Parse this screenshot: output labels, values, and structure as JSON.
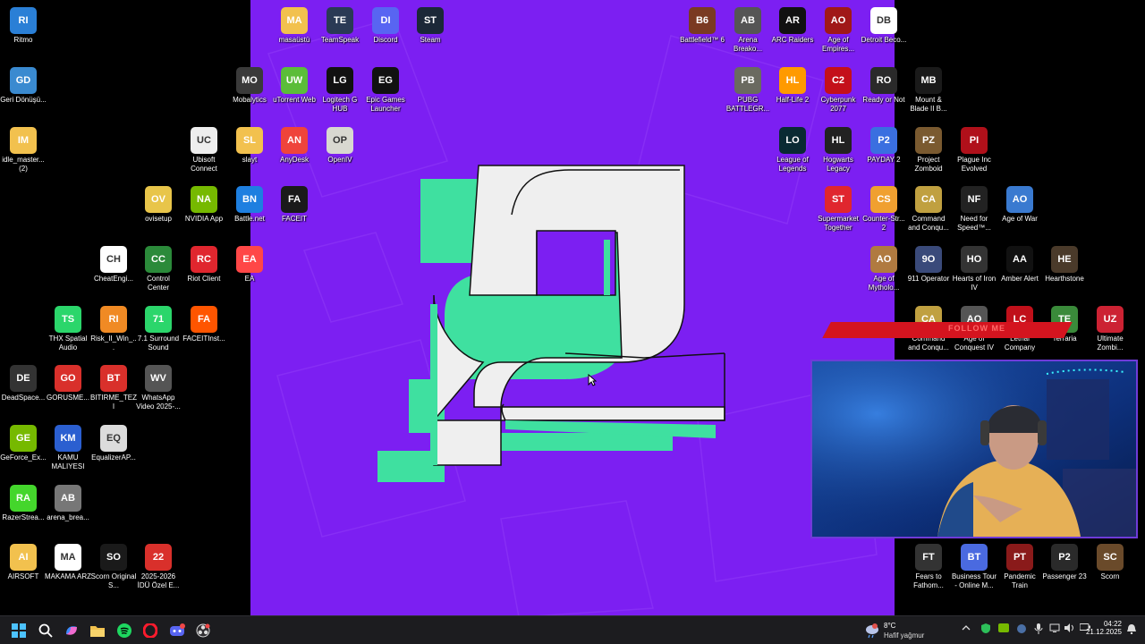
{
  "desktop_icons_left": [
    {
      "label": "Ritmo",
      "icon": "monitor-icon",
      "color": "#2a7fd6"
    },
    {
      "label": "Geri Dönüşü...",
      "icon": "recycle-bin-icon",
      "color": "#3a8ad0"
    },
    {
      "label": "idle_master... (2)",
      "icon": "folder-icon",
      "color": "#f2c14e"
    },
    {
      "label": "DeadSpace...",
      "icon": "deadspace-icon",
      "color": "#333333"
    },
    {
      "label": "GeForce_Ex...",
      "icon": "nvidia-icon",
      "color": "#76b900"
    },
    {
      "label": "RazerStrea...",
      "icon": "razer-icon",
      "color": "#44d62c"
    },
    {
      "label": "AIRSOFT",
      "icon": "folder-icon",
      "color": "#f2c14e"
    },
    {
      "label": "THX Spatial Audio",
      "icon": "thx-icon",
      "color": "#2bd66b"
    },
    {
      "label": "GORUSME...",
      "icon": "pdf-icon",
      "color": "#d9302b"
    },
    {
      "label": "KAMU MALIYESI",
      "icon": "word-icon",
      "color": "#2b5fd0"
    },
    {
      "label": "arena_brea...",
      "icon": "image-icon",
      "color": "#777777"
    },
    {
      "label": "MAKAMA ARZ",
      "icon": "document-icon",
      "color": "#ffffff"
    },
    {
      "label": "ovisetup",
      "icon": "file-icon",
      "color": "#e8c54a"
    },
    {
      "label": "CheatEngi...",
      "icon": "download-icon",
      "color": "#ffffff"
    },
    {
      "label": "Risk_II_Win_...",
      "icon": "folder-icon",
      "color": "#f08a24"
    },
    {
      "label": "BITIRME_TEZI",
      "icon": "pdf-icon",
      "color": "#d9302b"
    },
    {
      "label": "EqualizerAP...",
      "icon": "equalizer-icon",
      "color": "#dcdcdc"
    },
    {
      "label": "Scorn Original S...",
      "icon": "music-icon",
      "color": "#1a1a1a"
    },
    {
      "label": "Ubisoft Connect",
      "icon": "ubisoft-icon",
      "color": "#eeeeee"
    },
    {
      "label": "NVIDIA App",
      "icon": "nvidia-icon",
      "color": "#76b900"
    },
    {
      "label": "Control Center",
      "icon": "control-center-icon",
      "color": "#2b8a3a"
    },
    {
      "label": "7.1 Surround Sound",
      "icon": "surround-icon",
      "color": "#2bd66b"
    },
    {
      "label": "WhatsApp Video 2025-...",
      "icon": "video-icon",
      "color": "#555555"
    },
    {
      "label": "2025-2026 İDÜ Özel E...",
      "icon": "pdf-icon",
      "color": "#d9302b"
    },
    {
      "label": "slayt",
      "icon": "folder-icon",
      "color": "#f2c14e"
    },
    {
      "label": "Battle.net",
      "icon": "battlenet-icon",
      "color": "#1e7fe0"
    },
    {
      "label": "Riot Client",
      "icon": "riot-icon",
      "color": "#e0262e"
    },
    {
      "label": "FACEITInst...",
      "icon": "faceit-icon",
      "color": "#ff5500"
    },
    {
      "label": "EA",
      "icon": "ea-icon",
      "color": "#ff4747"
    }
  ],
  "desktop_icons_wall": [
    {
      "label": "masaüstü",
      "icon": "folder-icon",
      "color": "#f2c14e"
    },
    {
      "label": "TeamSpeak",
      "icon": "teamspeak-icon",
      "color": "#2a3a55"
    },
    {
      "label": "Discord",
      "icon": "discord-icon",
      "color": "#5865f2"
    },
    {
      "label": "Steam",
      "icon": "steam-icon",
      "color": "#1b2838"
    },
    {
      "label": "Mobalytics",
      "icon": "mobalytics-icon",
      "color": "#3a3a3a"
    },
    {
      "label": "uTorrent Web",
      "icon": "utorrent-icon",
      "color": "#5bbd39"
    },
    {
      "label": "Logitech G HUB",
      "icon": "logitech-icon",
      "color": "#111111"
    },
    {
      "label": "Epic Games Launcher",
      "icon": "epic-icon",
      "color": "#111111"
    },
    {
      "label": "AnyDesk",
      "icon": "anydesk-icon",
      "color": "#ef443b"
    },
    {
      "label": "OpenIV",
      "icon": "openiv-icon",
      "color": "#d8d8d0"
    },
    {
      "label": "FACEIT",
      "icon": "faceit-icon",
      "color": "#1a1a1a"
    }
  ],
  "desktop_icons_right": [
    {
      "label": "Battlefield™ 6",
      "icon": "battlefield-icon",
      "color": "#7a3a22"
    },
    {
      "label": "Arena Breako...",
      "icon": "arena-icon",
      "color": "#555555"
    },
    {
      "label": "ARC Raiders",
      "icon": "arc-raiders-icon",
      "color": "#111111"
    },
    {
      "label": "Age of Empires...",
      "icon": "aoe-icon",
      "color": "#a01818"
    },
    {
      "label": "Detroit Beco...",
      "icon": "detroit-icon",
      "color": "#ffffff"
    },
    {
      "label": "PUBG BATTLEGR...",
      "icon": "pubg-icon",
      "color": "#6a6a60"
    },
    {
      "label": "Half-Life 2",
      "icon": "halflife-icon",
      "color": "#ff9a00"
    },
    {
      "label": "Cyberpunk 2077",
      "icon": "cyberpunk-icon",
      "color": "#c4101a"
    },
    {
      "label": "Ready or Not",
      "icon": "ready-or-not-icon",
      "color": "#2a2a2a"
    },
    {
      "label": "Mount & Blade II B...",
      "icon": "bannerlord-icon",
      "color": "#1a1a1a"
    },
    {
      "label": "League of Legends",
      "icon": "lol-icon",
      "color": "#0a2a33"
    },
    {
      "label": "Hogwarts Legacy",
      "icon": "hogwarts-icon",
      "color": "#222222"
    },
    {
      "label": "PAYDAY 2",
      "icon": "payday-icon",
      "color": "#3a6fe0"
    },
    {
      "label": "Project Zomboid",
      "icon": "zomboid-icon",
      "color": "#7a5a30"
    },
    {
      "label": "Plague Inc Evolved",
      "icon": "plague-icon",
      "color": "#b0101a"
    },
    {
      "label": "Supermarket Together",
      "icon": "supermarket-icon",
      "color": "#e0262e"
    },
    {
      "label": "Counter-Str... 2",
      "icon": "cs2-icon",
      "color": "#f0a030"
    },
    {
      "label": "Command and Conqu...",
      "icon": "cnc-icon",
      "color": "#c0a040"
    },
    {
      "label": "Need for Speed™...",
      "icon": "nfs-icon",
      "color": "#222222"
    },
    {
      "label": "Age of War",
      "icon": "age-of-war-icon",
      "color": "#3a7ad0"
    },
    {
      "label": "Age of Mytholo...",
      "icon": "aom-icon",
      "color": "#b07a40"
    },
    {
      "label": "911 Operator",
      "icon": "operator-icon",
      "color": "#3a4a7a"
    },
    {
      "label": "Hearts of Iron IV",
      "icon": "hoi-icon",
      "color": "#333333"
    },
    {
      "label": "Amber Alert",
      "icon": "amber-alert-icon",
      "color": "#111111"
    },
    {
      "label": "Hearthstone",
      "icon": "hearthstone-icon",
      "color": "#4a3a2a"
    },
    {
      "label": "Command and Conqu...",
      "icon": "cnc-icon",
      "color": "#c0a040"
    },
    {
      "label": "Age of Conquest IV",
      "icon": "aoc-icon",
      "color": "#555555"
    },
    {
      "label": "Lethal Company",
      "icon": "lethal-icon",
      "color": "#c0101a"
    },
    {
      "label": "Terraria",
      "icon": "terraria-icon",
      "color": "#3a8a3a"
    },
    {
      "label": "Ultimate Zombi...",
      "icon": "zombie-icon",
      "color": "#cc2233"
    },
    {
      "label": "Fears to Fathom...",
      "icon": "fears-icon",
      "color": "#333333"
    },
    {
      "label": "Business Tour - Online M...",
      "icon": "business-tour-icon",
      "color": "#4a6ae0"
    },
    {
      "label": "Pandemic Train",
      "icon": "pandemic-icon",
      "color": "#8a1a1a"
    },
    {
      "label": "Passenger 23",
      "icon": "passenger-icon",
      "color": "#2a2a2a"
    },
    {
      "label": "Scorn",
      "icon": "scorn-icon",
      "color": "#6a4a2a"
    }
  ],
  "overlay": {
    "banner_text": "FOLLOW ME"
  },
  "taskbar": {
    "apps": [
      {
        "name": "start-button",
        "icon": "windows-icon"
      },
      {
        "name": "search-button",
        "icon": "search-icon"
      },
      {
        "name": "copilot-button",
        "icon": "copilot-icon"
      },
      {
        "name": "file-explorer-button",
        "icon": "folder-icon"
      },
      {
        "name": "spotify-button",
        "icon": "spotify-icon"
      },
      {
        "name": "opera-button",
        "icon": "opera-icon"
      },
      {
        "name": "discord-button",
        "icon": "discord-icon"
      },
      {
        "name": "obs-button",
        "icon": "obs-icon"
      }
    ],
    "weather": {
      "temp": "8°C",
      "condition": "Hafif yağmur"
    },
    "clock": {
      "time": "04:22",
      "date": "21.12.2025"
    }
  }
}
